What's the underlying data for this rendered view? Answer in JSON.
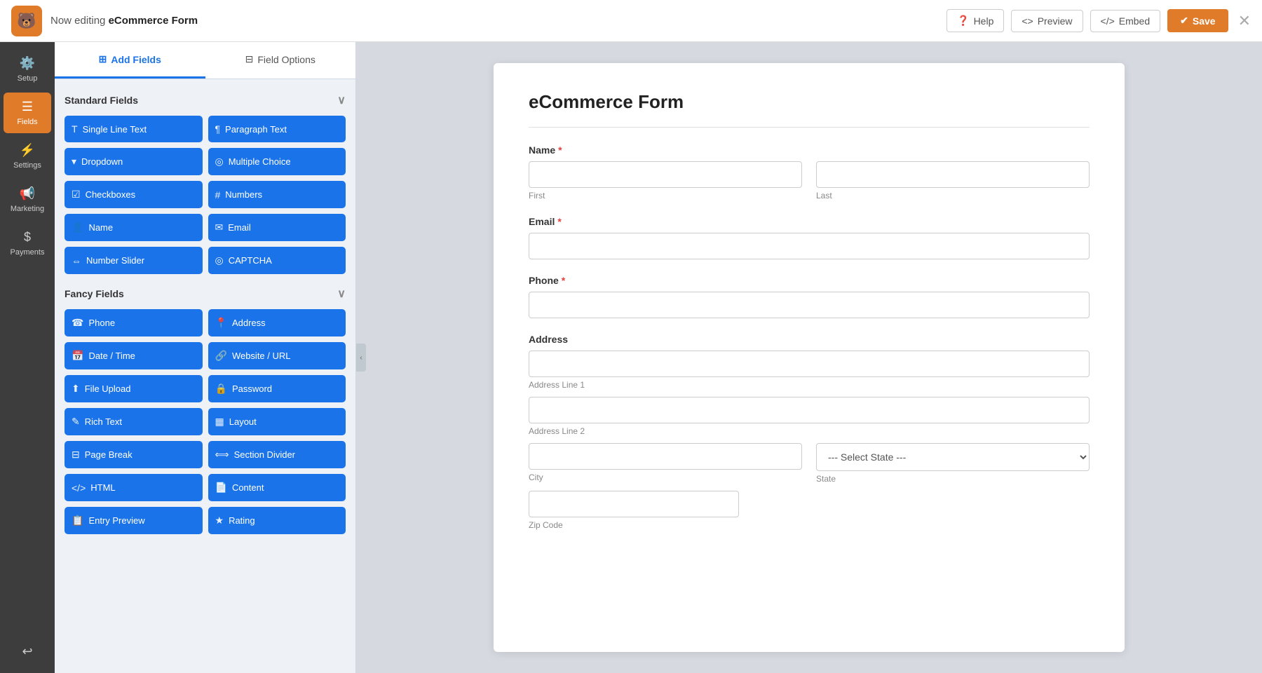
{
  "topbar": {
    "logo_emoji": "🐻",
    "editing_prefix": "Now editing",
    "form_name": "eCommerce Form",
    "help_label": "Help",
    "preview_label": "Preview",
    "embed_label": "Embed",
    "save_label": "Save"
  },
  "left_nav": {
    "items": [
      {
        "id": "setup",
        "label": "Setup",
        "icon": "⚙️"
      },
      {
        "id": "fields",
        "label": "Fields",
        "icon": "☰",
        "active": true
      },
      {
        "id": "settings",
        "label": "Settings",
        "icon": "⚡"
      },
      {
        "id": "marketing",
        "label": "Marketing",
        "icon": "📢"
      },
      {
        "id": "payments",
        "label": "Payments",
        "icon": "💲"
      }
    ],
    "bottom": {
      "id": "undo",
      "icon": "↩"
    }
  },
  "panel": {
    "tab_add_fields": "Add Fields",
    "tab_field_options": "Field Options",
    "sections": [
      {
        "title": "Standard Fields",
        "fields": [
          {
            "label": "Single Line Text",
            "icon": "T"
          },
          {
            "label": "Paragraph Text",
            "icon": "¶"
          },
          {
            "label": "Dropdown",
            "icon": "▾"
          },
          {
            "label": "Multiple Choice",
            "icon": "◎"
          },
          {
            "label": "Checkboxes",
            "icon": "☑"
          },
          {
            "label": "Numbers",
            "icon": "#"
          },
          {
            "label": "Name",
            "icon": "👤"
          },
          {
            "label": "Email",
            "icon": "✉"
          },
          {
            "label": "Number Slider",
            "icon": "⇔"
          },
          {
            "label": "CAPTCHA",
            "icon": "◎"
          }
        ]
      },
      {
        "title": "Fancy Fields",
        "fields": [
          {
            "label": "Phone",
            "icon": "☎"
          },
          {
            "label": "Address",
            "icon": "📍"
          },
          {
            "label": "Date / Time",
            "icon": "📅"
          },
          {
            "label": "Website / URL",
            "icon": "🔗"
          },
          {
            "label": "File Upload",
            "icon": "⬆"
          },
          {
            "label": "Password",
            "icon": "🔒"
          },
          {
            "label": "Rich Text",
            "icon": "✎"
          },
          {
            "label": "Layout",
            "icon": "▦"
          },
          {
            "label": "Page Break",
            "icon": "⊟"
          },
          {
            "label": "Section Divider",
            "icon": "⟺"
          },
          {
            "label": "HTML",
            "icon": "<>"
          },
          {
            "label": "Content",
            "icon": "📄"
          },
          {
            "label": "Entry Preview",
            "icon": "📋"
          },
          {
            "label": "Rating",
            "icon": "★"
          }
        ]
      }
    ]
  },
  "form": {
    "title": "eCommerce Form",
    "fields": [
      {
        "type": "name",
        "label": "Name",
        "required": true,
        "subfields": [
          {
            "placeholder": "",
            "sublabel": "First"
          },
          {
            "placeholder": "",
            "sublabel": "Last"
          }
        ]
      },
      {
        "type": "email",
        "label": "Email",
        "required": true,
        "placeholder": ""
      },
      {
        "type": "phone",
        "label": "Phone",
        "required": true,
        "placeholder": ""
      },
      {
        "type": "address",
        "label": "Address",
        "required": false,
        "subfields": {
          "line1_placeholder": "",
          "line1_label": "Address Line 1",
          "line2_placeholder": "",
          "line2_label": "Address Line 2",
          "city_placeholder": "",
          "city_label": "City",
          "state_default": "--- Select State ---",
          "state_label": "State",
          "zip_placeholder": "",
          "zip_label": "Zip Code"
        }
      }
    ]
  }
}
